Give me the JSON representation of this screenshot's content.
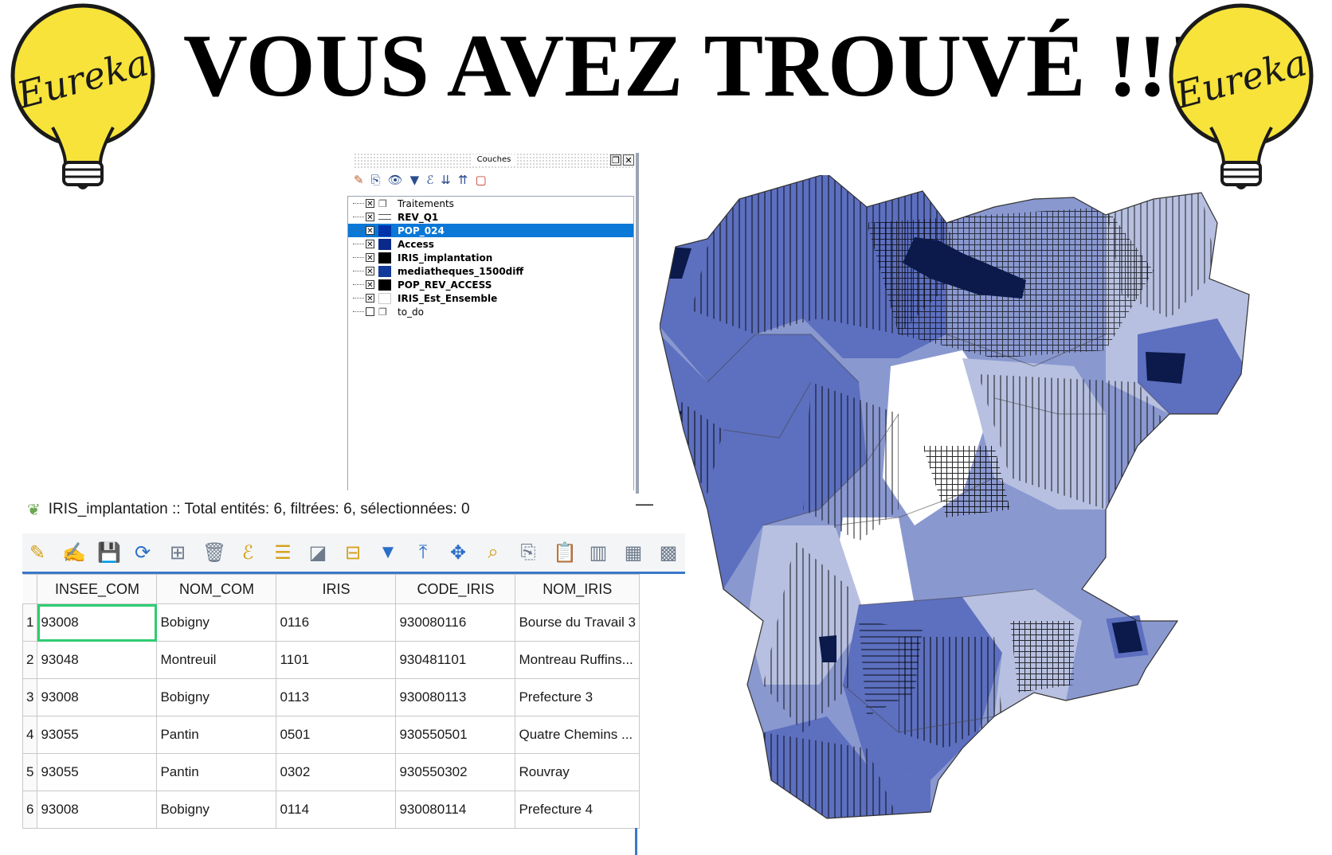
{
  "headline": "VOUS AVEZ TROUVÉ !!!",
  "logos": {
    "left_text": "Eureka",
    "right_text": "Eureka"
  },
  "layers_panel": {
    "title": "Couches",
    "window_buttons": [
      "restore-icon",
      "close-icon"
    ],
    "toolbar_icons": [
      "style-brush-icon",
      "add-layer-icon",
      "eye-icon",
      "filter-icon",
      "expression-icon",
      "expand-all-icon",
      "collapse-all-icon",
      "remove-layer-icon"
    ],
    "layers": [
      {
        "label": "Traitements",
        "checked": true,
        "bold": false,
        "group": true
      },
      {
        "label": "REV_Q1",
        "checked": true,
        "bold": true,
        "swatch": "line"
      },
      {
        "label": "POP_024",
        "checked": true,
        "bold": true,
        "swatch": "#0033aa",
        "selected": true
      },
      {
        "label": "Access",
        "checked": true,
        "bold": true,
        "swatch": "#0a2a8a"
      },
      {
        "label": "IRIS_implantation",
        "checked": true,
        "bold": true,
        "swatch": "#000000"
      },
      {
        "label": "mediatheques_1500diff",
        "checked": true,
        "bold": true,
        "swatch": "#123a9a"
      },
      {
        "label": "POP_REV_ACCESS",
        "checked": true,
        "bold": true,
        "swatch": "#000000"
      },
      {
        "label": "IRIS_Est_Ensemble",
        "checked": true,
        "bold": true,
        "swatch": "#ffffff"
      },
      {
        "label": "to_do",
        "checked": false,
        "bold": false,
        "group": true
      }
    ]
  },
  "attribute_table": {
    "title": "IRIS_implantation :: Total entités: 6, filtrées: 6, sélectionnées: 0",
    "minimize_label": "—",
    "columns": [
      "INSEE_COM",
      "NOM_COM",
      "IRIS",
      "CODE_IRIS",
      "NOM_IRIS"
    ],
    "rows": [
      {
        "num": "1",
        "cells": [
          "93008",
          "Bobigny",
          "0116",
          "930080116",
          "Bourse du Travail 3"
        ]
      },
      {
        "num": "2",
        "cells": [
          "93048",
          "Montreuil",
          "1101",
          "930481101",
          "Montreau Ruffins..."
        ]
      },
      {
        "num": "3",
        "cells": [
          "93008",
          "Bobigny",
          "0113",
          "930080113",
          "Prefecture 3"
        ]
      },
      {
        "num": "4",
        "cells": [
          "93055",
          "Pantin",
          "0501",
          "930550501",
          "Quatre Chemins ..."
        ]
      },
      {
        "num": "5",
        "cells": [
          "93055",
          "Pantin",
          "0302",
          "930550302",
          "Rouvray"
        ]
      },
      {
        "num": "6",
        "cells": [
          "93008",
          "Bobigny",
          "0114",
          "930080114",
          "Prefecture 4"
        ]
      }
    ]
  },
  "map": {
    "colors": {
      "light": "#b7c0e0",
      "mid": "#8a98d0",
      "dark": "#5d6fbf",
      "selected": "#0b1a4a",
      "white": "#ffffff"
    }
  }
}
